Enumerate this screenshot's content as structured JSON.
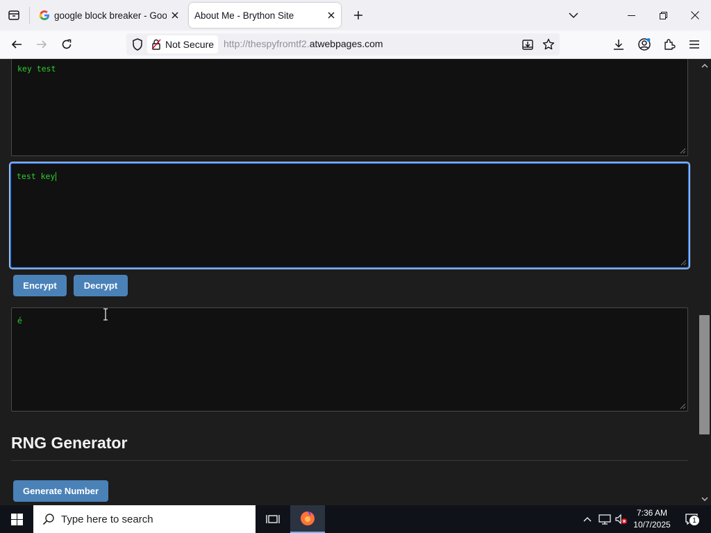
{
  "browser": {
    "tabs": [
      {
        "title": "google block breaker - Google",
        "active": false
      },
      {
        "title": "About Me - Brython Site",
        "active": true
      }
    ],
    "security_label": "Not Secure",
    "url_prefix": "http://thespyfromtf2.",
    "url_domain": "atwebpages.com"
  },
  "page": {
    "key_textarea_value": "key test",
    "input_textarea_value": "test key",
    "encrypt_button": "Encrypt",
    "decrypt_button": "Decrypt",
    "output_textarea_value": "é",
    "rng_heading": "RNG Generator",
    "generate_button": "Generate Number",
    "text_color": "#2ecc2e",
    "button_color": "#4a82b8"
  },
  "taskbar": {
    "search_placeholder": "Type here to search",
    "time": "7:36 AM",
    "date": "10/7/2025",
    "notification_count": "1"
  }
}
